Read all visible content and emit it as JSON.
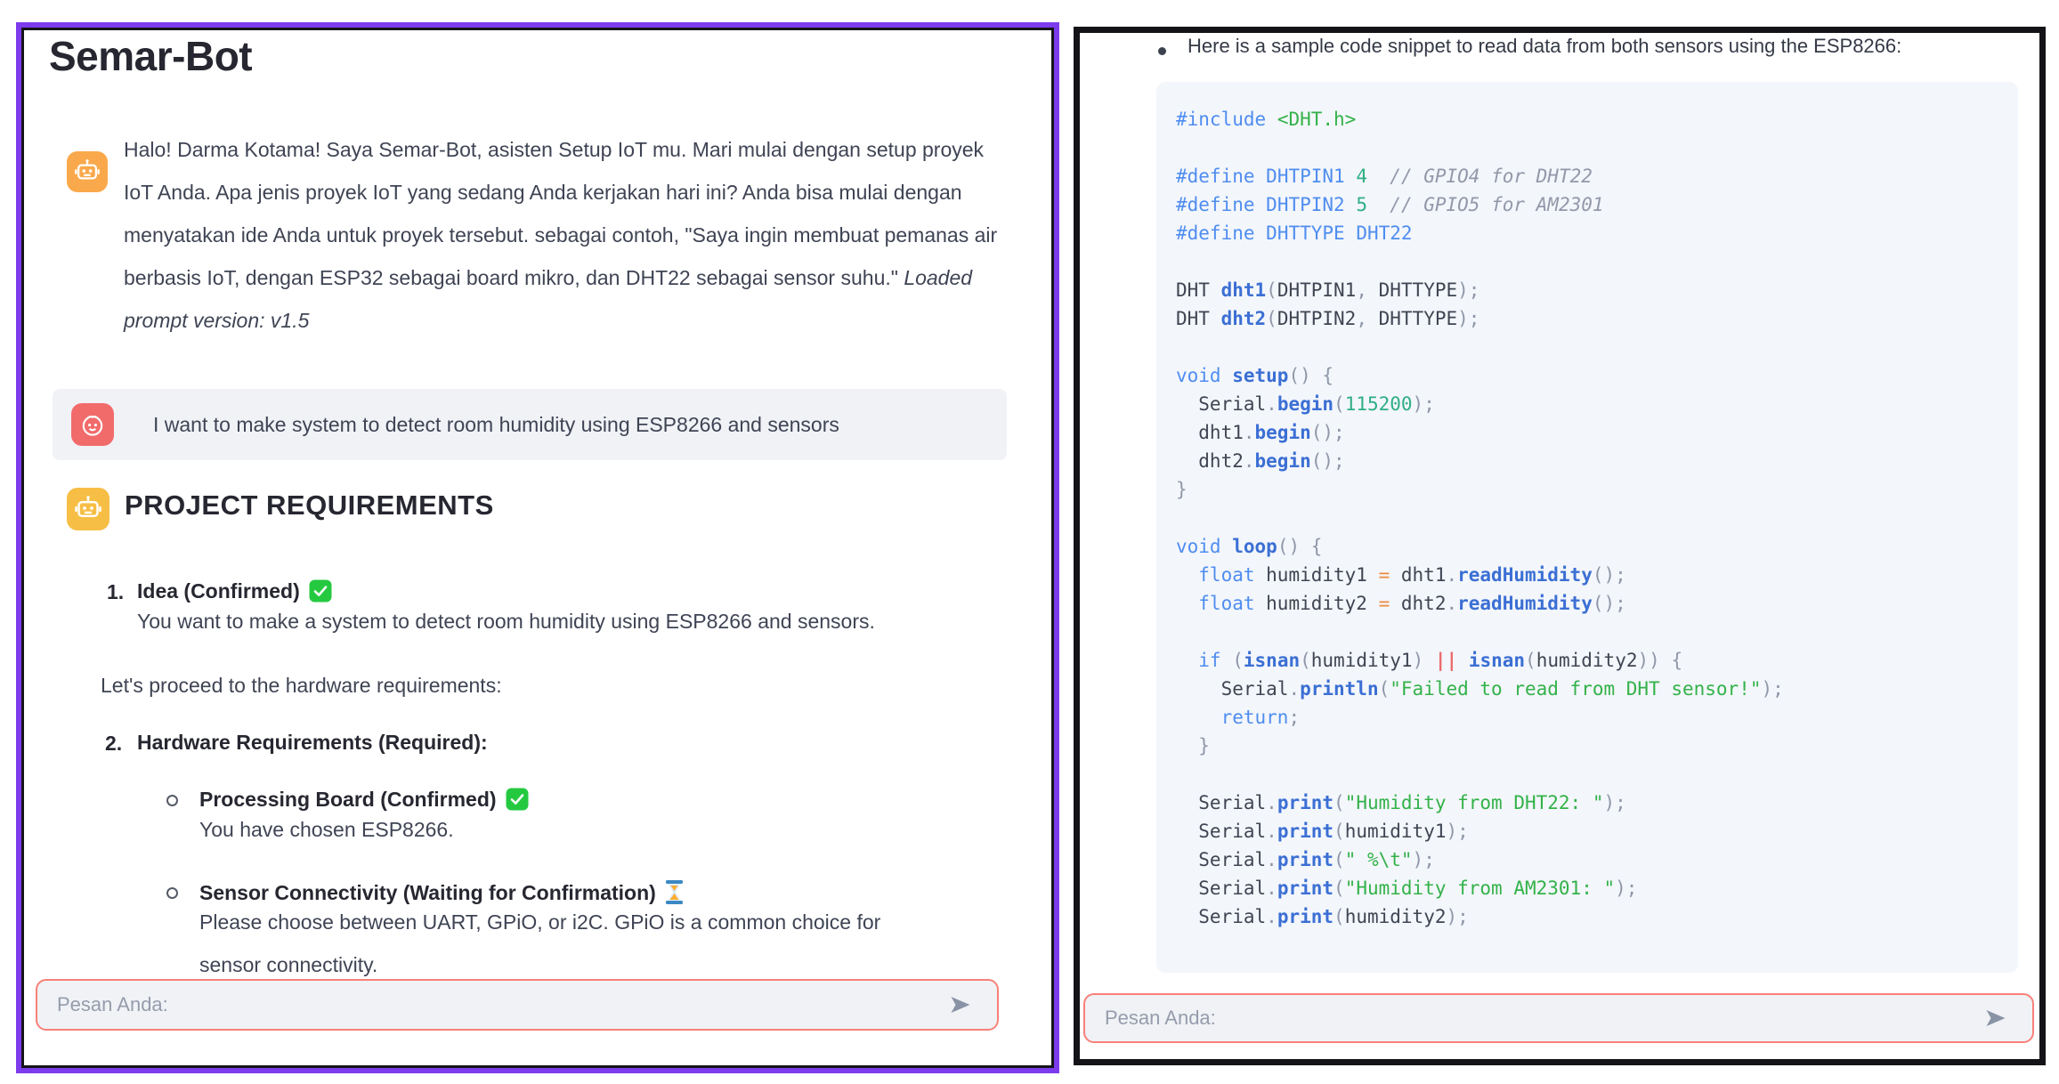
{
  "left_panel": {
    "title": "Semar-Bot",
    "bot_message": {
      "text_main": "Halo! Darma Kotama! Saya Semar-Bot, asisten Setup IoT mu. Mari mulai dengan setup proyek IoT Anda. Apa jenis proyek IoT yang sedang Anda kerjakan hari ini? Anda bisa mulai dengan menyatakan ide Anda untuk proyek tersebut. sebagai contoh, \"Saya ingin membuat pemanas air berbasis IoT, dengan ESP32 sebagai board mikro, dan DHT22 sebagai sensor suhu.\" ",
      "text_italic": "Loaded prompt version: v1.5"
    },
    "user_message": "I want to make system to detect room humidity using ESP8266 and sensors",
    "section_heading": "PROJECT REQUIREMENTS",
    "requirements": {
      "item1_number": "1.",
      "item1_title": "Idea (Confirmed)",
      "item1_status_icon": "check-mark",
      "item1_body": "You want to make a system to detect room humidity using ESP8266 and sensors.",
      "interlude": "Let's proceed to the hardware requirements:",
      "item2_number": "2.",
      "item2_title": "Hardware Requirements (Required):",
      "sub1_title": "Processing Board (Confirmed)",
      "sub1_status_icon": "check-mark",
      "sub1_body": "You have chosen ESP8266.",
      "sub2_title": "Sensor Connectivity (Waiting for Confirmation)",
      "sub2_status_icon": "hourglass",
      "sub2_body": "Please choose between UART, GPiO, or i2C. GPiO is a common choice for sensor connectivity."
    },
    "input_placeholder": "Pesan Anda:"
  },
  "right_panel": {
    "bullet_text": "Here is a sample code snippet to read data from both sensors using the ESP8266:",
    "code_lines": [
      [
        [
          "kw",
          "#include"
        ],
        [
          "pl",
          " "
        ],
        [
          "str",
          "<DHT.h>"
        ]
      ],
      [],
      [
        [
          "kw",
          "#define"
        ],
        [
          "pl",
          " "
        ],
        [
          "kw",
          "DHTPIN1"
        ],
        [
          "pl",
          " "
        ],
        [
          "num",
          "4"
        ],
        [
          "pl",
          "  "
        ],
        [
          "com",
          "// GPIO4 for DHT22"
        ]
      ],
      [
        [
          "kw",
          "#define"
        ],
        [
          "pl",
          " "
        ],
        [
          "kw",
          "DHTPIN2"
        ],
        [
          "pl",
          " "
        ],
        [
          "num",
          "5"
        ],
        [
          "pl",
          "  "
        ],
        [
          "com",
          "// GPIO5 for AM2301"
        ]
      ],
      [
        [
          "kw",
          "#define"
        ],
        [
          "pl",
          " "
        ],
        [
          "kw",
          "DHTTYPE"
        ],
        [
          "pl",
          " "
        ],
        [
          "kw",
          "DHT22"
        ]
      ],
      [],
      [
        [
          "pl",
          "DHT "
        ],
        [
          "fn",
          "dht1"
        ],
        [
          "pun",
          "("
        ],
        [
          "pl",
          "DHTPIN1"
        ],
        [
          "pun",
          ","
        ],
        [
          "pl",
          " DHTTYPE"
        ],
        [
          "pun",
          ");"
        ]
      ],
      [
        [
          "pl",
          "DHT "
        ],
        [
          "fn",
          "dht2"
        ],
        [
          "pun",
          "("
        ],
        [
          "pl",
          "DHTPIN2"
        ],
        [
          "pun",
          ","
        ],
        [
          "pl",
          " DHTTYPE"
        ],
        [
          "pun",
          ");"
        ]
      ],
      [],
      [
        [
          "kw",
          "void"
        ],
        [
          "pl",
          " "
        ],
        [
          "fn",
          "setup"
        ],
        [
          "pun",
          "()"
        ],
        [
          "pl",
          " "
        ],
        [
          "pun",
          "{"
        ]
      ],
      [
        [
          "pl",
          "  Serial"
        ],
        [
          "pun",
          "."
        ],
        [
          "fn",
          "begin"
        ],
        [
          "pun",
          "("
        ],
        [
          "num",
          "115200"
        ],
        [
          "pun",
          ");"
        ]
      ],
      [
        [
          "pl",
          "  dht1"
        ],
        [
          "pun",
          "."
        ],
        [
          "fn",
          "begin"
        ],
        [
          "pun",
          "();"
        ]
      ],
      [
        [
          "pl",
          "  dht2"
        ],
        [
          "pun",
          "."
        ],
        [
          "fn",
          "begin"
        ],
        [
          "pun",
          "();"
        ]
      ],
      [
        [
          "pun",
          "}"
        ]
      ],
      [],
      [
        [
          "kw",
          "void"
        ],
        [
          "pl",
          " "
        ],
        [
          "fn",
          "loop"
        ],
        [
          "pun",
          "()"
        ],
        [
          "pl",
          " "
        ],
        [
          "pun",
          "{"
        ]
      ],
      [
        [
          "kw",
          "  float"
        ],
        [
          "pl",
          " humidity1 "
        ],
        [
          "op",
          "="
        ],
        [
          "pl",
          " dht1"
        ],
        [
          "pun",
          "."
        ],
        [
          "fn",
          "readHumidity"
        ],
        [
          "pun",
          "();"
        ]
      ],
      [
        [
          "kw",
          "  float"
        ],
        [
          "pl",
          " humidity2 "
        ],
        [
          "op",
          "="
        ],
        [
          "pl",
          " dht2"
        ],
        [
          "pun",
          "."
        ],
        [
          "fn",
          "readHumidity"
        ],
        [
          "pun",
          "();"
        ]
      ],
      [],
      [
        [
          "kw",
          "  if"
        ],
        [
          "pl",
          " "
        ],
        [
          "pun",
          "("
        ],
        [
          "fn",
          "isnan"
        ],
        [
          "pun",
          "("
        ],
        [
          "pl",
          "humidity1"
        ],
        [
          "pun",
          ")"
        ],
        [
          "pl",
          " "
        ],
        [
          "or",
          "||"
        ],
        [
          "pl",
          " "
        ],
        [
          "fn",
          "isnan"
        ],
        [
          "pun",
          "("
        ],
        [
          "pl",
          "humidity2"
        ],
        [
          "pun",
          "))"
        ],
        [
          "pl",
          " "
        ],
        [
          "pun",
          "{"
        ]
      ],
      [
        [
          "pl",
          "    Serial"
        ],
        [
          "pun",
          "."
        ],
        [
          "fn",
          "println"
        ],
        [
          "pun",
          "("
        ],
        [
          "str",
          "\"Failed to read from DHT sensor!\""
        ],
        [
          "pun",
          ");"
        ]
      ],
      [
        [
          "kw",
          "    return"
        ],
        [
          "pun",
          ";"
        ]
      ],
      [
        [
          "pun",
          "  }"
        ]
      ],
      [],
      [
        [
          "pl",
          "  Serial"
        ],
        [
          "pun",
          "."
        ],
        [
          "fn",
          "print"
        ],
        [
          "pun",
          "("
        ],
        [
          "str",
          "\"Humidity from DHT22: \""
        ],
        [
          "pun",
          ");"
        ]
      ],
      [
        [
          "pl",
          "  Serial"
        ],
        [
          "pun",
          "."
        ],
        [
          "fn",
          "print"
        ],
        [
          "pun",
          "("
        ],
        [
          "pl",
          "humidity1"
        ],
        [
          "pun",
          ");"
        ]
      ],
      [
        [
          "pl",
          "  Serial"
        ],
        [
          "pun",
          "."
        ],
        [
          "fn",
          "print"
        ],
        [
          "pun",
          "("
        ],
        [
          "str",
          "\" %\\t\""
        ],
        [
          "pun",
          ");"
        ]
      ],
      [
        [
          "pl",
          "  Serial"
        ],
        [
          "pun",
          "."
        ],
        [
          "fn",
          "print"
        ],
        [
          "pun",
          "("
        ],
        [
          "str",
          "\"Humidity from AM2301: \""
        ],
        [
          "pun",
          ");"
        ]
      ],
      [
        [
          "pl",
          "  Serial"
        ],
        [
          "pun",
          "."
        ],
        [
          "fn",
          "print"
        ],
        [
          "pun",
          "("
        ],
        [
          "pl",
          "humidity2"
        ],
        [
          "pun",
          ");"
        ]
      ]
    ],
    "input_placeholder": "Pesan Anda:"
  },
  "colors": {
    "panel_highlight_purple": "#7C3BEC",
    "panel_border_black": "#141418",
    "input_border_coral": "#F98078",
    "input_bg": "#F0F2F6",
    "user_box_bg": "#F0F2F6",
    "code_bg": "#F3F6FB",
    "bot_avatar_orange": "#F9A94B",
    "section_avatar_yellow": "#F7BE45",
    "user_avatar_coral": "#F26B6B",
    "check_green": "#25C940",
    "heading_text": "#262730",
    "body_text": "#3F4454",
    "placeholder_text": "#959CAB",
    "send_icon_gray": "#8A93A5",
    "code_keyword": "#4F8DF0",
    "code_function": "#3B6FD4",
    "code_string": "#33B249",
    "code_number": "#2FAE84",
    "code_comment": "#9298A9",
    "code_operator": "#EE8A3C",
    "code_logical": "#EC6B6B",
    "code_plain": "#3F4552",
    "code_punct": "#8F97A8",
    "hourglass_blue": "#3B88C3",
    "hourglass_sand": "#FFAC33"
  }
}
